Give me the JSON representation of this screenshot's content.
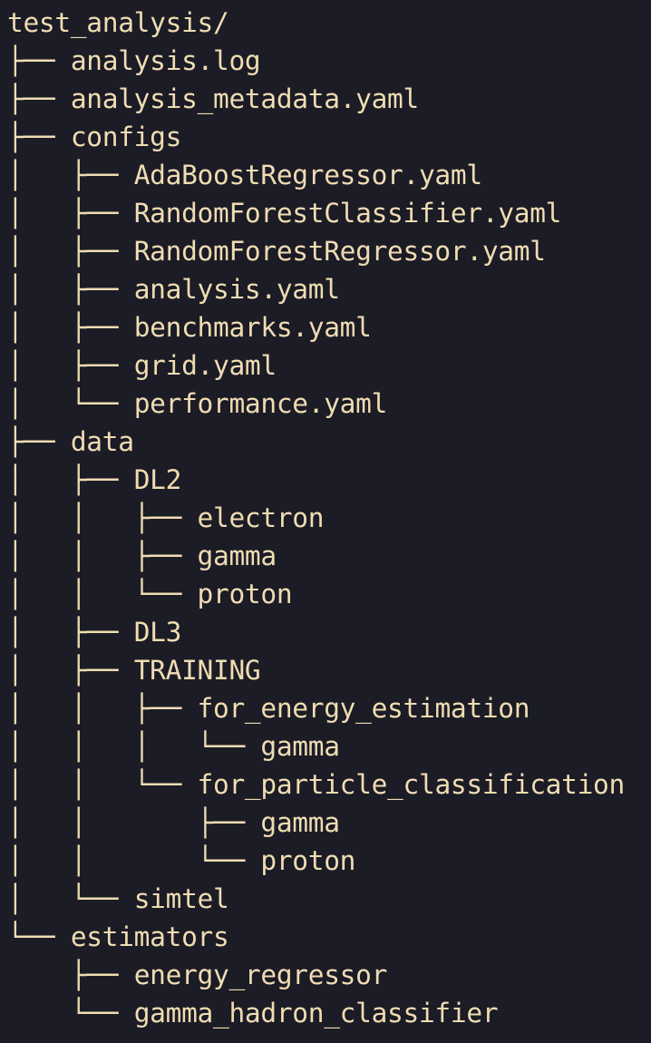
{
  "tree": {
    "lines": [
      {
        "guide": "",
        "label": "test_analysis/"
      },
      {
        "guide": "├── ",
        "label": "analysis.log"
      },
      {
        "guide": "├── ",
        "label": "analysis_metadata.yaml"
      },
      {
        "guide": "├── ",
        "label": "configs"
      },
      {
        "guide": "│   ├── ",
        "label": "AdaBoostRegressor.yaml"
      },
      {
        "guide": "│   ├── ",
        "label": "RandomForestClassifier.yaml"
      },
      {
        "guide": "│   ├── ",
        "label": "RandomForestRegressor.yaml"
      },
      {
        "guide": "│   ├── ",
        "label": "analysis.yaml"
      },
      {
        "guide": "│   ├── ",
        "label": "benchmarks.yaml"
      },
      {
        "guide": "│   ├── ",
        "label": "grid.yaml"
      },
      {
        "guide": "│   └── ",
        "label": "performance.yaml"
      },
      {
        "guide": "├── ",
        "label": "data"
      },
      {
        "guide": "│   ├── ",
        "label": "DL2"
      },
      {
        "guide": "│   │   ├── ",
        "label": "electron"
      },
      {
        "guide": "│   │   ├── ",
        "label": "gamma"
      },
      {
        "guide": "│   │   └── ",
        "label": "proton"
      },
      {
        "guide": "│   ├── ",
        "label": "DL3"
      },
      {
        "guide": "│   ├── ",
        "label": "TRAINING"
      },
      {
        "guide": "│   │   ├── ",
        "label": "for_energy_estimation"
      },
      {
        "guide": "│   │   │   └── ",
        "label": "gamma"
      },
      {
        "guide": "│   │   └── ",
        "label": "for_particle_classification"
      },
      {
        "guide": "│   │       ├── ",
        "label": "gamma"
      },
      {
        "guide": "│   │       └── ",
        "label": "proton"
      },
      {
        "guide": "│   └── ",
        "label": "simtel"
      },
      {
        "guide": "└── ",
        "label": "estimators"
      },
      {
        "guide": "    ├── ",
        "label": "energy_regressor"
      },
      {
        "guide": "    └── ",
        "label": "gamma_hadron_classifier"
      }
    ]
  },
  "colors": {
    "background": "#1c1c26",
    "text": "#efdcb2"
  }
}
